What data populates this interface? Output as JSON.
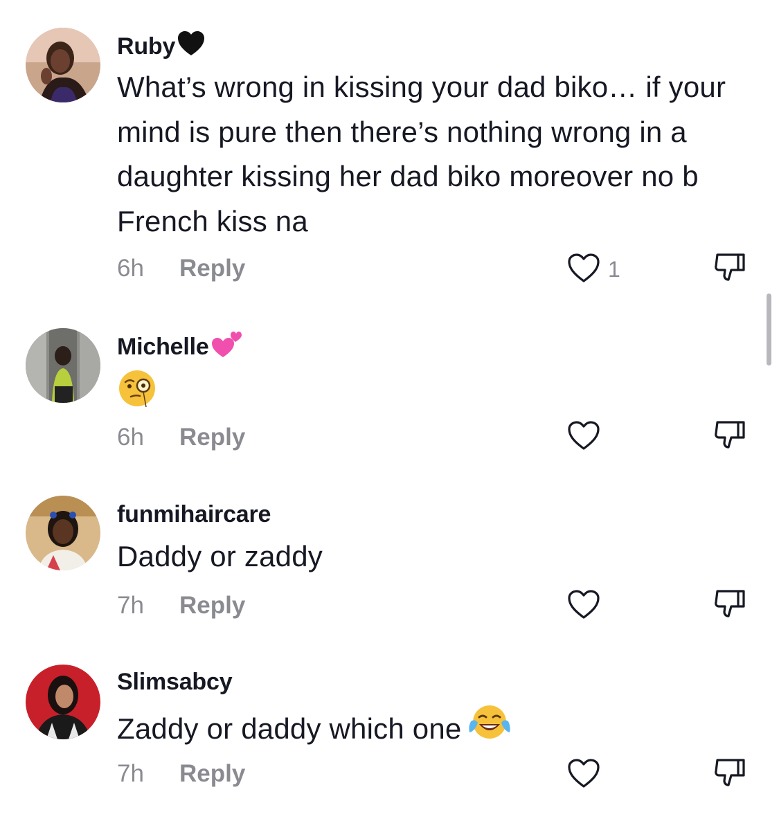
{
  "comments": [
    {
      "username": "Ruby",
      "username_badge": "black-heart",
      "text": "What’s wrong in kissing your dad biko… if your mind is pure then there’s nothing wrong in a daughter kissing her dad biko moreover no b French kiss na",
      "time": "6h",
      "reply_label": "Reply",
      "like_count": "1"
    },
    {
      "username": "Michelle",
      "username_badge": "revolving-hearts",
      "text": "",
      "text_emoji": "face-with-monocle",
      "time": "6h",
      "reply_label": "Reply",
      "like_count": ""
    },
    {
      "username": "funmihaircare",
      "text": "Daddy or zaddy",
      "time": "7h",
      "reply_label": "Reply",
      "like_count": ""
    },
    {
      "username": "Slimsabcy",
      "text": "Zaddy or daddy which one",
      "text_emoji": "face-with-tears-of-joy",
      "time": "7h",
      "reply_label": "Reply",
      "like_count": ""
    }
  ],
  "colors": {
    "text": "#161823",
    "secondary": "#8a8b91",
    "icon": "#161823",
    "scrollbar": "#b8b8bc"
  }
}
